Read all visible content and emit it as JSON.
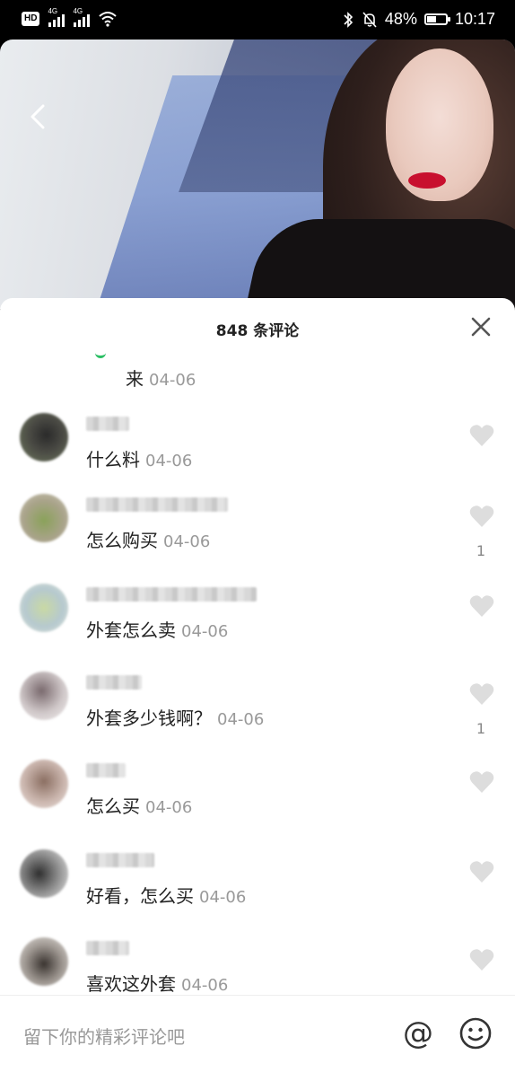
{
  "status_bar": {
    "hd": "HD",
    "signal1": "4G",
    "signal2": "4G",
    "battery_percent": "48%",
    "battery_level": 0.48,
    "time": "10:17"
  },
  "comments_panel": {
    "title": "848 条评论",
    "partial_comment": {
      "text": "来",
      "date": "04-06"
    },
    "comments": [
      {
        "text": "什么料",
        "date": "04-06",
        "likes": ""
      },
      {
        "text": "怎么购买",
        "date": "04-06",
        "likes": "1"
      },
      {
        "text": "外套怎么卖",
        "date": "04-06",
        "likes": ""
      },
      {
        "text": "外套多少钱啊？",
        "date": "04-06",
        "likes": "1"
      },
      {
        "text": "怎么买",
        "date": "04-06",
        "likes": ""
      },
      {
        "text": "好看，怎么买",
        "date": "04-06",
        "likes": ""
      },
      {
        "text": "喜欢这外套",
        "date": "04-06",
        "likes": ""
      }
    ],
    "input_placeholder": "留下你的精彩评论吧",
    "at_symbol": "@"
  },
  "icons": {
    "back": "chevron-left-icon",
    "close": "close-icon",
    "like": "heart-icon",
    "emoji": "smiley-icon",
    "wifi": "wifi-icon",
    "mute": "bell-off-icon",
    "vibrate": "vibrate-icon"
  },
  "colors": {
    "panel_bg": "#ffffff",
    "date_gray": "#999999",
    "heart_gray": "#dddddd",
    "lips_red": "#c8102e"
  }
}
